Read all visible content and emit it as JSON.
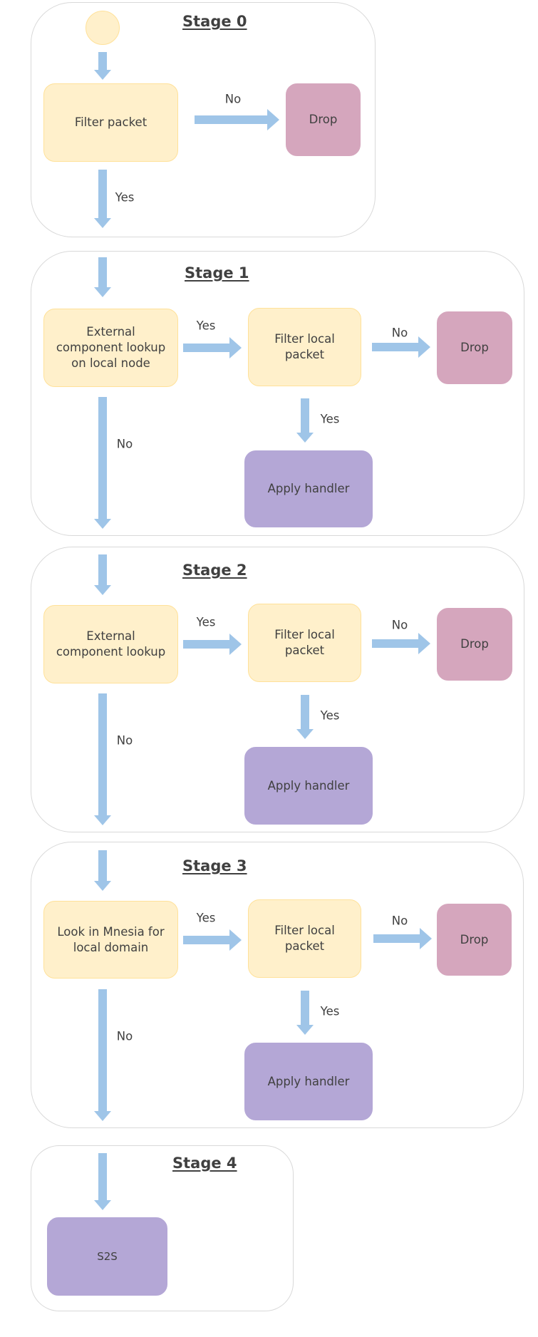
{
  "colors": {
    "decision_fill": "#fff0cb",
    "decision_border": "#ffe199",
    "drop_fill": "#d5a6bd",
    "action_fill": "#b4a7d6",
    "arrow": "#9fc5e8",
    "stage_border": "#d9d9d9",
    "text": "#404040"
  },
  "stages": [
    {
      "title": "Stage 0",
      "nodes": {
        "start": "",
        "filter": "Filter packet",
        "drop": "Drop"
      },
      "edges": {
        "no": "No",
        "yes": "Yes"
      }
    },
    {
      "title": "Stage 1",
      "nodes": {
        "lookup": "External component lookup on local node",
        "filter": "Filter local packet",
        "drop": "Drop",
        "handler": "Apply handler"
      },
      "edges": {
        "lookup_yes": "Yes",
        "filter_no": "No",
        "filter_yes": "Yes",
        "lookup_no": "No"
      }
    },
    {
      "title": "Stage 2",
      "nodes": {
        "lookup": "External component lookup",
        "filter": "Filter local packet",
        "drop": "Drop",
        "handler": "Apply handler"
      },
      "edges": {
        "lookup_yes": "Yes",
        "filter_no": "No",
        "filter_yes": "Yes",
        "lookup_no": "No"
      }
    },
    {
      "title": "Stage 3",
      "nodes": {
        "lookup": "Look in Mnesia for local domain",
        "filter": "Filter local packet",
        "drop": "Drop",
        "handler": "Apply handler"
      },
      "edges": {
        "lookup_yes": "Yes",
        "filter_no": "No",
        "filter_yes": "Yes",
        "lookup_no": "No"
      }
    },
    {
      "title": "Stage 4",
      "nodes": {
        "s2s": "S2S"
      }
    }
  ]
}
